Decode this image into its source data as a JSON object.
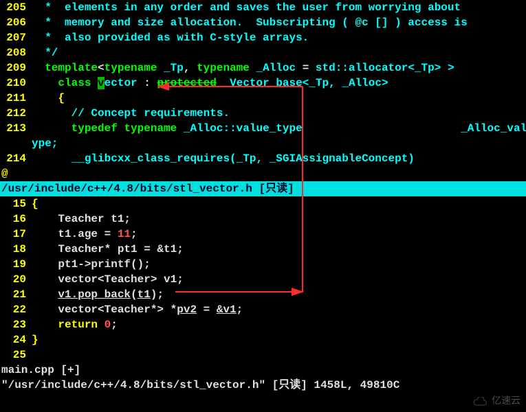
{
  "top": {
    "status": "/usr/include/c++/4.8/bits/stl_vector.h [只读]",
    "lines": [
      {
        "n": "205",
        "t": "  *  elements in any order and saves the user from worrying about"
      },
      {
        "n": "206",
        "t": "  *  memory and size allocation.  Subscripting ( @c [] ) access is"
      },
      {
        "n": "207",
        "t": "  *  also provided as with C-style arrays."
      },
      {
        "n": "208",
        "t": "  */"
      }
    ],
    "l209": {
      "n": "209",
      "kw1": "template",
      "kw2": "typename",
      "id1": "_Tp",
      "kw3": "typename",
      "id2": "_Alloc",
      "eq": "=",
      "ns": "std::allocator",
      "tail": "<_Tp> >"
    },
    "l210": {
      "n": "210",
      "kw": "class",
      "cur": "v",
      "id": "ector",
      "colon": ":",
      "prot": "protected",
      "base": "_Vector_base<_Tp, _Alloc>"
    },
    "l211": {
      "n": "211",
      "brace": "{"
    },
    "l212": {
      "n": "212",
      "cmt": "// Concept requirements."
    },
    "l213a": {
      "n": "213",
      "kw": "typedef",
      "kw2": "typename",
      "id": "_Alloc::value_type",
      "tail": "_Alloc_value_t"
    },
    "l213b": {
      "cont": "ype;"
    },
    "l214": {
      "n": "214",
      "fn": "__glibcxx_class_requires(_Tp, _SGIAssignableConcept)"
    },
    "at": "@"
  },
  "bottom": {
    "status": "main.cpp [+]",
    "l15": {
      "n": "15",
      "brace": "{"
    },
    "l16": {
      "n": "16",
      "t": "Teacher t1;"
    },
    "l17": {
      "n": "17",
      "p1": "t1.age = ",
      "num": "11",
      "p2": ";"
    },
    "l18": {
      "n": "18",
      "t": "Teacher* pt1 = &t1;"
    },
    "l19": {
      "n": "19",
      "t": "pt1->printf();"
    },
    "l20": {
      "n": "20",
      "t": "vector<Teacher> v1;"
    },
    "l21": {
      "n": "21",
      "u1": "v1.pop_back",
      "p1": "(",
      "u2": "t1",
      "p2": ");"
    },
    "l22": {
      "n": "22",
      "p1": "vector<Teacher*> *",
      "u1": "pv2",
      "p2": " = ",
      "u2": "&v1",
      "p3": ";"
    },
    "l23": {
      "n": "23",
      "kw": "return",
      "sp": " ",
      "num": "0",
      "p": ";"
    },
    "l24": {
      "n": "24",
      "brace": "}"
    },
    "l25": {
      "n": "25",
      "t": ""
    }
  },
  "cmd": {
    "text": "\"/usr/include/c++/4.8/bits/stl_vector.h\" [只读] 1458L, 49810C"
  },
  "watermark": "亿速云"
}
